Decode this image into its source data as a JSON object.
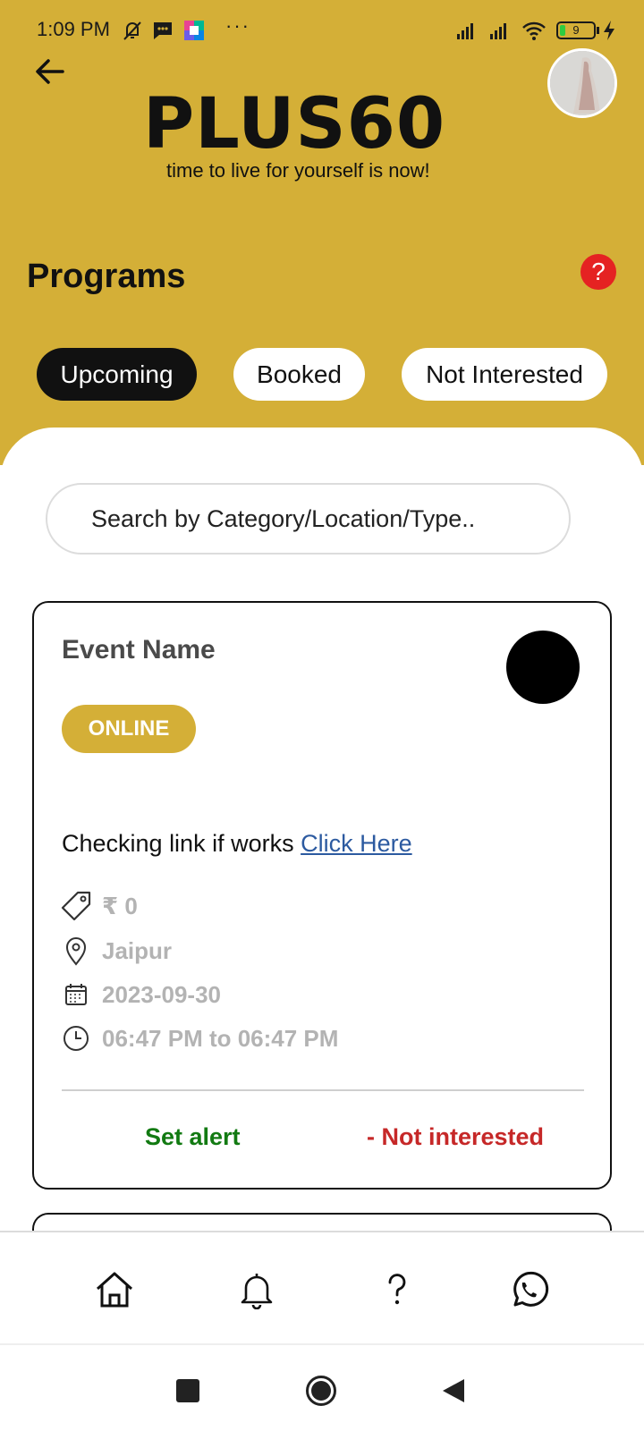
{
  "status_bar": {
    "time": "1:09 PM",
    "overflow": "···",
    "battery": "9"
  },
  "header": {
    "logo_text": "PLUS60",
    "tagline": "time to live for yourself is now!",
    "title": "Programs",
    "help_label": "?"
  },
  "tabs": [
    {
      "label": "Upcoming",
      "active": true
    },
    {
      "label": "Booked",
      "active": false
    },
    {
      "label": "Not Interested",
      "active": false
    }
  ],
  "search": {
    "placeholder": "Search by Category/Location/Type.."
  },
  "event": {
    "name": "Event Name",
    "mode": "ONLINE",
    "description": "Checking link if works",
    "link_text": "Click Here",
    "price": "₹ 0",
    "location": "Jaipur",
    "date": "2023-09-30",
    "time": "06:47 PM to 06:47 PM",
    "set_alert": "Set alert",
    "not_interested": "- Not interested"
  },
  "colors": {
    "brand": "#D4AF37",
    "active_tab": "#111111",
    "help": "#E52222",
    "link": "#2C5AA0",
    "set_alert": "#127A12",
    "not_interested": "#C62828"
  },
  "bottom_nav": {
    "items": [
      "home-icon",
      "bell-icon",
      "question-icon",
      "whatsapp-icon"
    ]
  }
}
